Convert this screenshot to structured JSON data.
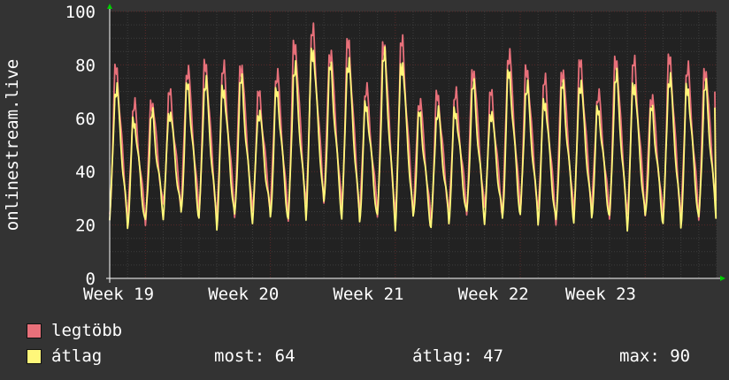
{
  "colors": {
    "background": "#333333",
    "plot_background": "#222222",
    "grid_minor": "#3d3d3d",
    "grid_major": "#5a2a2a",
    "axis": "#ffffff",
    "series_max": "#e8707a",
    "series_avg": "#fff77a",
    "arrow": "#00cc00"
  },
  "chart_data": {
    "type": "line",
    "title": "",
    "xlabel": "",
    "ylabel": "onlinestream.live",
    "ylim": [
      0,
      100
    ],
    "y_ticks": [
      "0",
      "20",
      "40",
      "60",
      "80",
      "100"
    ],
    "x_tick_labels": [
      "Week 19",
      "Week 20",
      "Week 21",
      "Week 22",
      "Week 23"
    ],
    "grid": true,
    "series": [
      {
        "name": "legtöbb",
        "color": "#e8707a",
        "daily_peaks": [
          80,
          66,
          68,
          70,
          80,
          82,
          80,
          82,
          70,
          78,
          90,
          94,
          87,
          90,
          72,
          90,
          90,
          68,
          70,
          70,
          80,
          70,
          86,
          80,
          75,
          80,
          82,
          70,
          84,
          82,
          70,
          84,
          80,
          80
        ],
        "daily_troughs": [
          24,
          22,
          22,
          26,
          27,
          25,
          22,
          25,
          24,
          26,
          23,
          26,
          30,
          26,
          24,
          25,
          22,
          25,
          21,
          24,
          26,
          25,
          24,
          26,
          24,
          22,
          24,
          26,
          24,
          22,
          25,
          23,
          22,
          24
        ]
      },
      {
        "name": "átlag",
        "color": "#fff77a",
        "daily_peaks": [
          73,
          60,
          62,
          64,
          73,
          75,
          73,
          75,
          64,
          71,
          80,
          88,
          80,
          83,
          66,
          85,
          83,
          62,
          64,
          64,
          73,
          64,
          78,
          73,
          68,
          73,
          75,
          64,
          77,
          75,
          64,
          77,
          73,
          73
        ],
        "daily_troughs": [
          22,
          20,
          20,
          24,
          24,
          22,
          20,
          22,
          22,
          23,
          21,
          24,
          27,
          23,
          22,
          22,
          20,
          22,
          19,
          22,
          23,
          22,
          22,
          23,
          22,
          20,
          22,
          23,
          22,
          20,
          22,
          21,
          20,
          21
        ]
      }
    ],
    "end_value": 64
  },
  "legend": {
    "items": [
      {
        "label": "legtöbb",
        "color": "#e8707a"
      },
      {
        "label": "átlag",
        "color": "#fff77a",
        "stats": {
          "now": "most: 64",
          "avg": "átlag: 47",
          "max": "max: 90"
        }
      }
    ]
  }
}
